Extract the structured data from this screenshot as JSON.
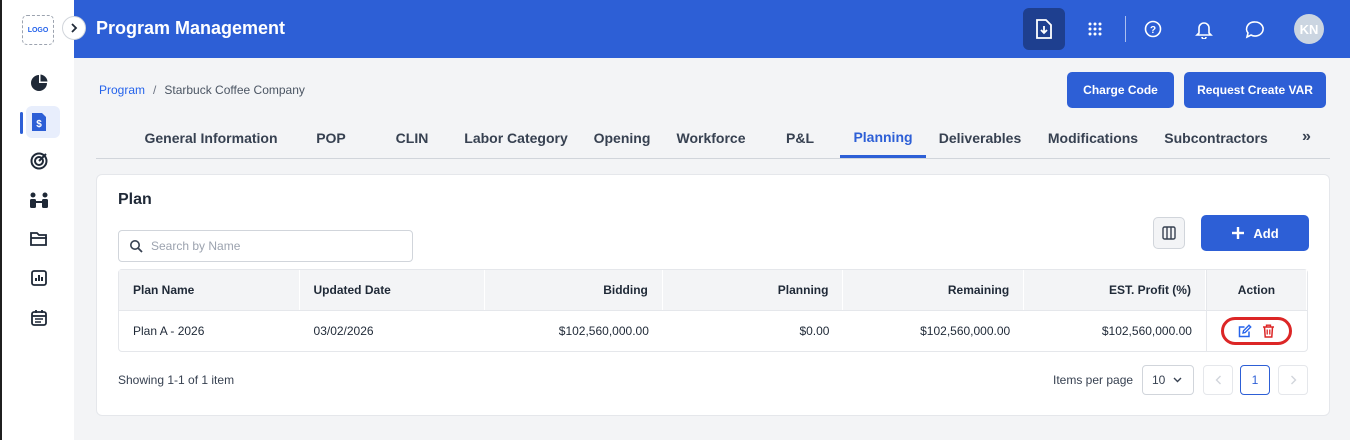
{
  "app": {
    "logo_text": "LOGO",
    "title": "Program Management",
    "avatar_initials": "KN",
    "accent_color": "#2d5fd6",
    "danger_color": "#dc2626"
  },
  "sidebar": {
    "items": [
      {
        "icon": "pie-chart-icon"
      },
      {
        "icon": "dollar-document-icon",
        "active": true
      },
      {
        "icon": "target-icon"
      },
      {
        "icon": "people-icon"
      },
      {
        "icon": "folder-icon"
      },
      {
        "icon": "bar-chart-icon"
      },
      {
        "icon": "calendar-icon"
      }
    ]
  },
  "header_icons": [
    "download-icon",
    "apps-grid-icon",
    "help-icon",
    "bell-icon",
    "chat-icon"
  ],
  "breadcrumb": {
    "root": "Program",
    "separator": "/",
    "current": "Starbuck Coffee Company"
  },
  "actions": {
    "charge_code": "Charge Code",
    "request_var": "Request Create VAR"
  },
  "tabs": [
    {
      "label": "General Information"
    },
    {
      "label": "POP"
    },
    {
      "label": "CLIN"
    },
    {
      "label": "Labor Category"
    },
    {
      "label": "Opening"
    },
    {
      "label": "Workforce"
    },
    {
      "label": "P&L"
    },
    {
      "label": "Planning",
      "active": true
    },
    {
      "label": "Deliverables"
    },
    {
      "label": "Modifications"
    },
    {
      "label": "Subcontractors"
    }
  ],
  "tabs_more": "»",
  "plan": {
    "title": "Plan",
    "search_placeholder": "Search by Name",
    "add_label": "Add",
    "columns": [
      "Plan Name",
      "Updated Date",
      "Bidding",
      "Planning",
      "Remaining",
      "EST. Profit (%)",
      "Action"
    ],
    "rows": [
      {
        "name": "Plan A - 2026",
        "updated": "03/02/2026",
        "bidding": "$102,560,000.00",
        "planning": "$0.00",
        "remaining": "$102,560,000.00",
        "profit": "$102,560,000.00"
      }
    ],
    "showing": "Showing 1-1 of 1 item",
    "items_per_page_label": "Items per page",
    "items_per_page": "10",
    "current_page": "1"
  }
}
